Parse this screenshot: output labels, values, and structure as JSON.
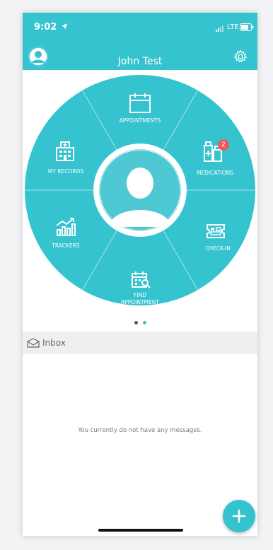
{
  "status_bar": {
    "time": "9:02",
    "network": "LTE"
  },
  "header": {
    "user_name": "John Test"
  },
  "wheel": {
    "segments": [
      {
        "label": "APPOINTMENTS",
        "icon": "calendar-icon"
      },
      {
        "label": "MEDICATIONS",
        "icon": "medications-icon",
        "badge": "2"
      },
      {
        "label": "CHECK-IN",
        "icon": "ticket-icon"
      },
      {
        "label": "FIND",
        "label2": "APPOINTMENT",
        "icon": "calendar-search-icon"
      },
      {
        "label": "TRACKERS",
        "icon": "chart-trend-icon"
      },
      {
        "label": "MY RECORDS",
        "icon": "hospital-icon"
      }
    ],
    "center": "profile-avatar-icon"
  },
  "pager": {
    "pages": 2,
    "active_index": 1
  },
  "inbox": {
    "title": "Inbox",
    "empty_message": "You currently do not have any messages."
  },
  "colors": {
    "accent": "#35c3cf",
    "badge": "#ec5a5f",
    "background": "#ffffff"
  }
}
